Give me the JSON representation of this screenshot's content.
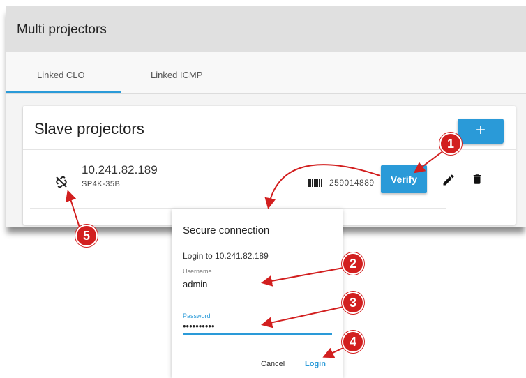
{
  "window": {
    "title": "Multi projectors"
  },
  "tabs": [
    {
      "label": "Linked CLO",
      "active": true
    },
    {
      "label": "Linked ICMP",
      "active": false
    }
  ],
  "card": {
    "title": "Slave projectors",
    "add_label": "+",
    "row": {
      "ip": "10.241.82.189",
      "model": "SP4K-35B",
      "serial": "259014889",
      "verify_label": "Verify",
      "status_icon": "link-off-icon"
    }
  },
  "dialog": {
    "title": "Secure connection",
    "subtitle": "Login to 10.241.82.189",
    "username_label": "Username",
    "username_value": "admin",
    "password_label": "Password",
    "password_value": "••••••••••",
    "cancel_label": "Cancel",
    "login_label": "Login"
  },
  "callouts": [
    "1",
    "2",
    "3",
    "4",
    "5"
  ],
  "colors": {
    "accent": "#2a9ad8",
    "callout": "#d21f1f"
  }
}
